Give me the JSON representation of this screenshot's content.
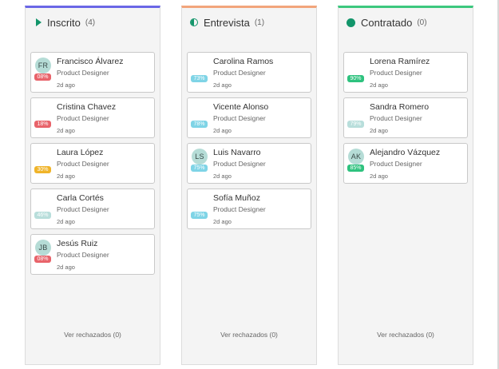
{
  "columns": [
    {
      "title": "Inscrito",
      "count": "(4)",
      "accent": "#6a67e6",
      "icon": "play-icon",
      "rejected_label": "Ver rechazados (0)",
      "cards": [
        {
          "name": "Francisco Álvarez",
          "role": "Product Designer",
          "time": "2d ago",
          "initials": "FR",
          "score": "08%",
          "score_color": "#e8636a"
        },
        {
          "name": "Cristina Chavez",
          "role": "Product Designer",
          "time": "2d ago",
          "initials": "",
          "score": "18%",
          "score_color": "#e8636a"
        },
        {
          "name": "Laura López",
          "role": "Product Designer",
          "time": "2d ago",
          "initials": "",
          "score": "30%",
          "score_color": "#f0b429"
        },
        {
          "name": "Carla Cortés",
          "role": "Product Designer",
          "time": "2d ago",
          "initials": "",
          "score": "46%",
          "score_color": "#b8dedb"
        },
        {
          "name": "Jesús Ruiz",
          "role": "Product Designer",
          "time": "2d ago",
          "initials": "JB",
          "score": "08%",
          "score_color": "#e8636a"
        }
      ]
    },
    {
      "title": "Entrevista",
      "count": "(1)",
      "accent": "#f2a57b",
      "icon": "half-circle-icon",
      "rejected_label": "Ver rechazados (0)",
      "cards": [
        {
          "name": "Carolina Ramos",
          "role": "Product Designer",
          "time": "2d ago",
          "initials": "",
          "score": "73%",
          "score_color": "#7fd4e6"
        },
        {
          "name": "Vicente Alonso",
          "role": "Product Designer",
          "time": "2d ago",
          "initials": "",
          "score": "78%",
          "score_color": "#7fd4e6"
        },
        {
          "name": "Luis Navarro",
          "role": "Product Designer",
          "time": "2d ago",
          "initials": "LS",
          "score": "75%",
          "score_color": "#7fd4e6"
        },
        {
          "name": "Sofía Muñoz",
          "role": "Product Designer",
          "time": "2d ago",
          "initials": "",
          "score": "75%",
          "score_color": "#7fd4e6"
        }
      ]
    },
    {
      "title": "Contratado",
      "count": "(0)",
      "accent": "#3cc77e",
      "icon": "full-circle-icon",
      "rejected_label": "Ver rechazados (0)",
      "cards": [
        {
          "name": "Lorena Ramírez",
          "role": "Product Designer",
          "time": "2d ago",
          "initials": "",
          "score": "90%",
          "score_color": "#2ec27e"
        },
        {
          "name": "Sandra Romero",
          "role": "Product Designer",
          "time": "2d ago",
          "initials": "",
          "score": "79%",
          "score_color": "#b8dedb"
        },
        {
          "name": "Alejandro Vázquez",
          "role": "Product Designer",
          "time": "2d ago",
          "initials": "AK",
          "score": "85%",
          "score_color": "#2ec27e"
        }
      ]
    }
  ]
}
